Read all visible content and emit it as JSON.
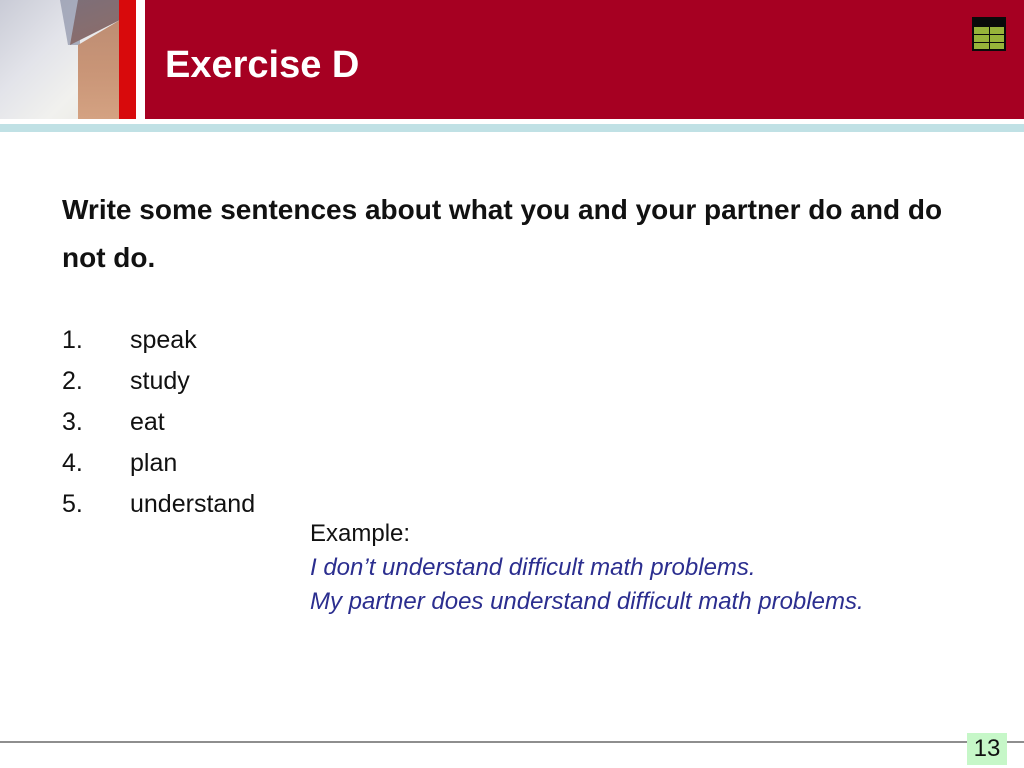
{
  "slide": {
    "title": "Exercise D",
    "header_icon": "table-grid-icon",
    "instruction": "Write some sentences about what you and your partner do and do not do.",
    "items": [
      {
        "number": "1.",
        "text": "speak"
      },
      {
        "number": "2.",
        "text": "study"
      },
      {
        "number": "3.",
        "text": "eat"
      },
      {
        "number": "4.",
        "text": "plan"
      },
      {
        "number": "5.",
        "text": "understand"
      }
    ],
    "example": {
      "label": "Example:",
      "sentences": [
        "I don’t understand difficult math problems.",
        "My partner does understand difficult math problems."
      ]
    },
    "page_number": "13"
  },
  "colors": {
    "header_band": "#a60022",
    "accent_stripe": "#d80a0c",
    "divider_bar": "#c0e1e5",
    "example_text": "#2b2e8f",
    "page_number_bg": "#c6f7c8"
  }
}
